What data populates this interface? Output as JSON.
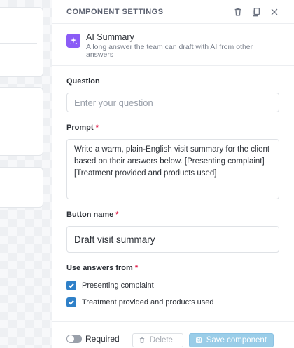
{
  "panel": {
    "title": "COMPONENT SETTINGS",
    "icons": [
      "trash-icon",
      "copy-icon",
      "close-icon"
    ]
  },
  "component": {
    "name": "AI Summary",
    "description": "A long answer the team can draft with AI from other answers",
    "icon": "sparkle-icon",
    "icon_color": "#8b5cf6"
  },
  "question": {
    "label": "Question",
    "value": "",
    "placeholder": "Enter your question"
  },
  "prompt": {
    "label": "Prompt",
    "required_mark": "*",
    "value": "Write a warm, plain-English visit summary for the client based on their answers below. [Presenting complaint] [Treatment provided and products used]"
  },
  "button_name": {
    "label": "Button name",
    "required_mark": "*",
    "value": "Draft visit summary"
  },
  "use_answers": {
    "label": "Use answers from",
    "required_mark": "*",
    "options": [
      {
        "label": "Presenting complaint",
        "checked": true
      },
      {
        "label": "Treatment provided and products used",
        "checked": true
      }
    ]
  },
  "footer": {
    "required_label": "Required",
    "required_on": false,
    "delete_label": "Delete",
    "save_label": "Save component"
  },
  "colors": {
    "accent": "#2f80c8",
    "save_button": "#9acde8",
    "required_mark": "#e11d48"
  }
}
